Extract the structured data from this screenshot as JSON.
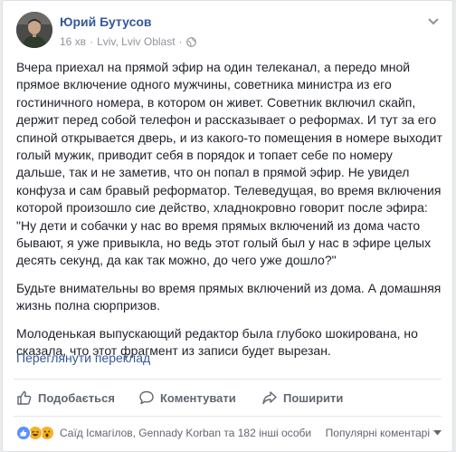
{
  "post": {
    "author": "Юрий Бутусов",
    "time": "16 хв",
    "separator": "·",
    "location": "Lviv, Lviv Oblast",
    "separator2": "·",
    "paragraphs": [
      "Вчера приехал на прямой эфир на один телеканал, а передо мной прямое включение одного мужчины, советника министра из его гостиничного номера, в котором он живет. Советник включил скайп, держит перед собой телефон и рассказывает о реформах. И тут за его спиной открывается дверь, и из какого-то помещения в номере выходит голый мужик, приводит себя в порядок и топает себе по номеру дальше, так и не заметив, что он попал в прямой эфир. Не увидел конфуза и сам бравый реформатор. Телеведущая, во время включения которой произошло сие действо, хладнокровно говорит после эфира: \"Ну дети и собачки у нас во время прямых включений из дома часто бывают, я уже привыкла, но ведь этот голый был у нас в эфире целых десять секунд, да как так можно, до чего уже дошло?\"",
      "Будьте внимательны во время прямых включений из дома. А домашняя жизнь полна сюрпризов.",
      "Молоденькая выпускающий редактор была глубоко шокирована, но сказала, что этот фрагмент из записи будет вырезан."
    ],
    "translate_link": "Переглянути переклад"
  },
  "actions": {
    "like": "Подобається",
    "comment": "Коментувати",
    "share": "Поширити"
  },
  "reactions": {
    "names": "Саїд Ісмагілов, Gennady Korban та 182 інші особи",
    "sort_label": "Популярні коментарі"
  },
  "colors": {
    "link": "#365899",
    "text": "#1d2129",
    "muted": "#90949c",
    "like_blue": "#5890ff",
    "haha_yellow": "#f7b125"
  }
}
